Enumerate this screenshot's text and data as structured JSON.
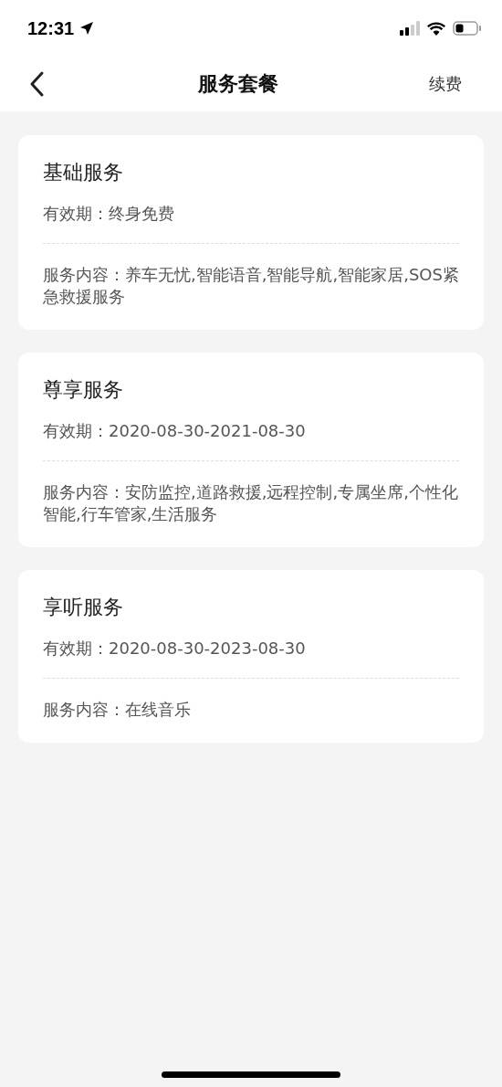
{
  "status_bar": {
    "time": "12:31"
  },
  "nav": {
    "title": "服务套餐",
    "action": "续费"
  },
  "packages": [
    {
      "name": "基础服务",
      "validity": "有效期：终身免费",
      "content": "服务内容：养车无忧,智能语音,智能导航,智能家居,SOS紧急救援服务"
    },
    {
      "name": "尊享服务",
      "validity": "有效期：2020-08-30-2021-08-30",
      "content": "服务内容：安防监控,道路救援,远程控制,专属坐席,个性化智能,行车管家,生活服务"
    },
    {
      "name": "享听服务",
      "validity": "有效期：2020-08-30-2023-08-30",
      "content": "服务内容：在线音乐"
    }
  ]
}
